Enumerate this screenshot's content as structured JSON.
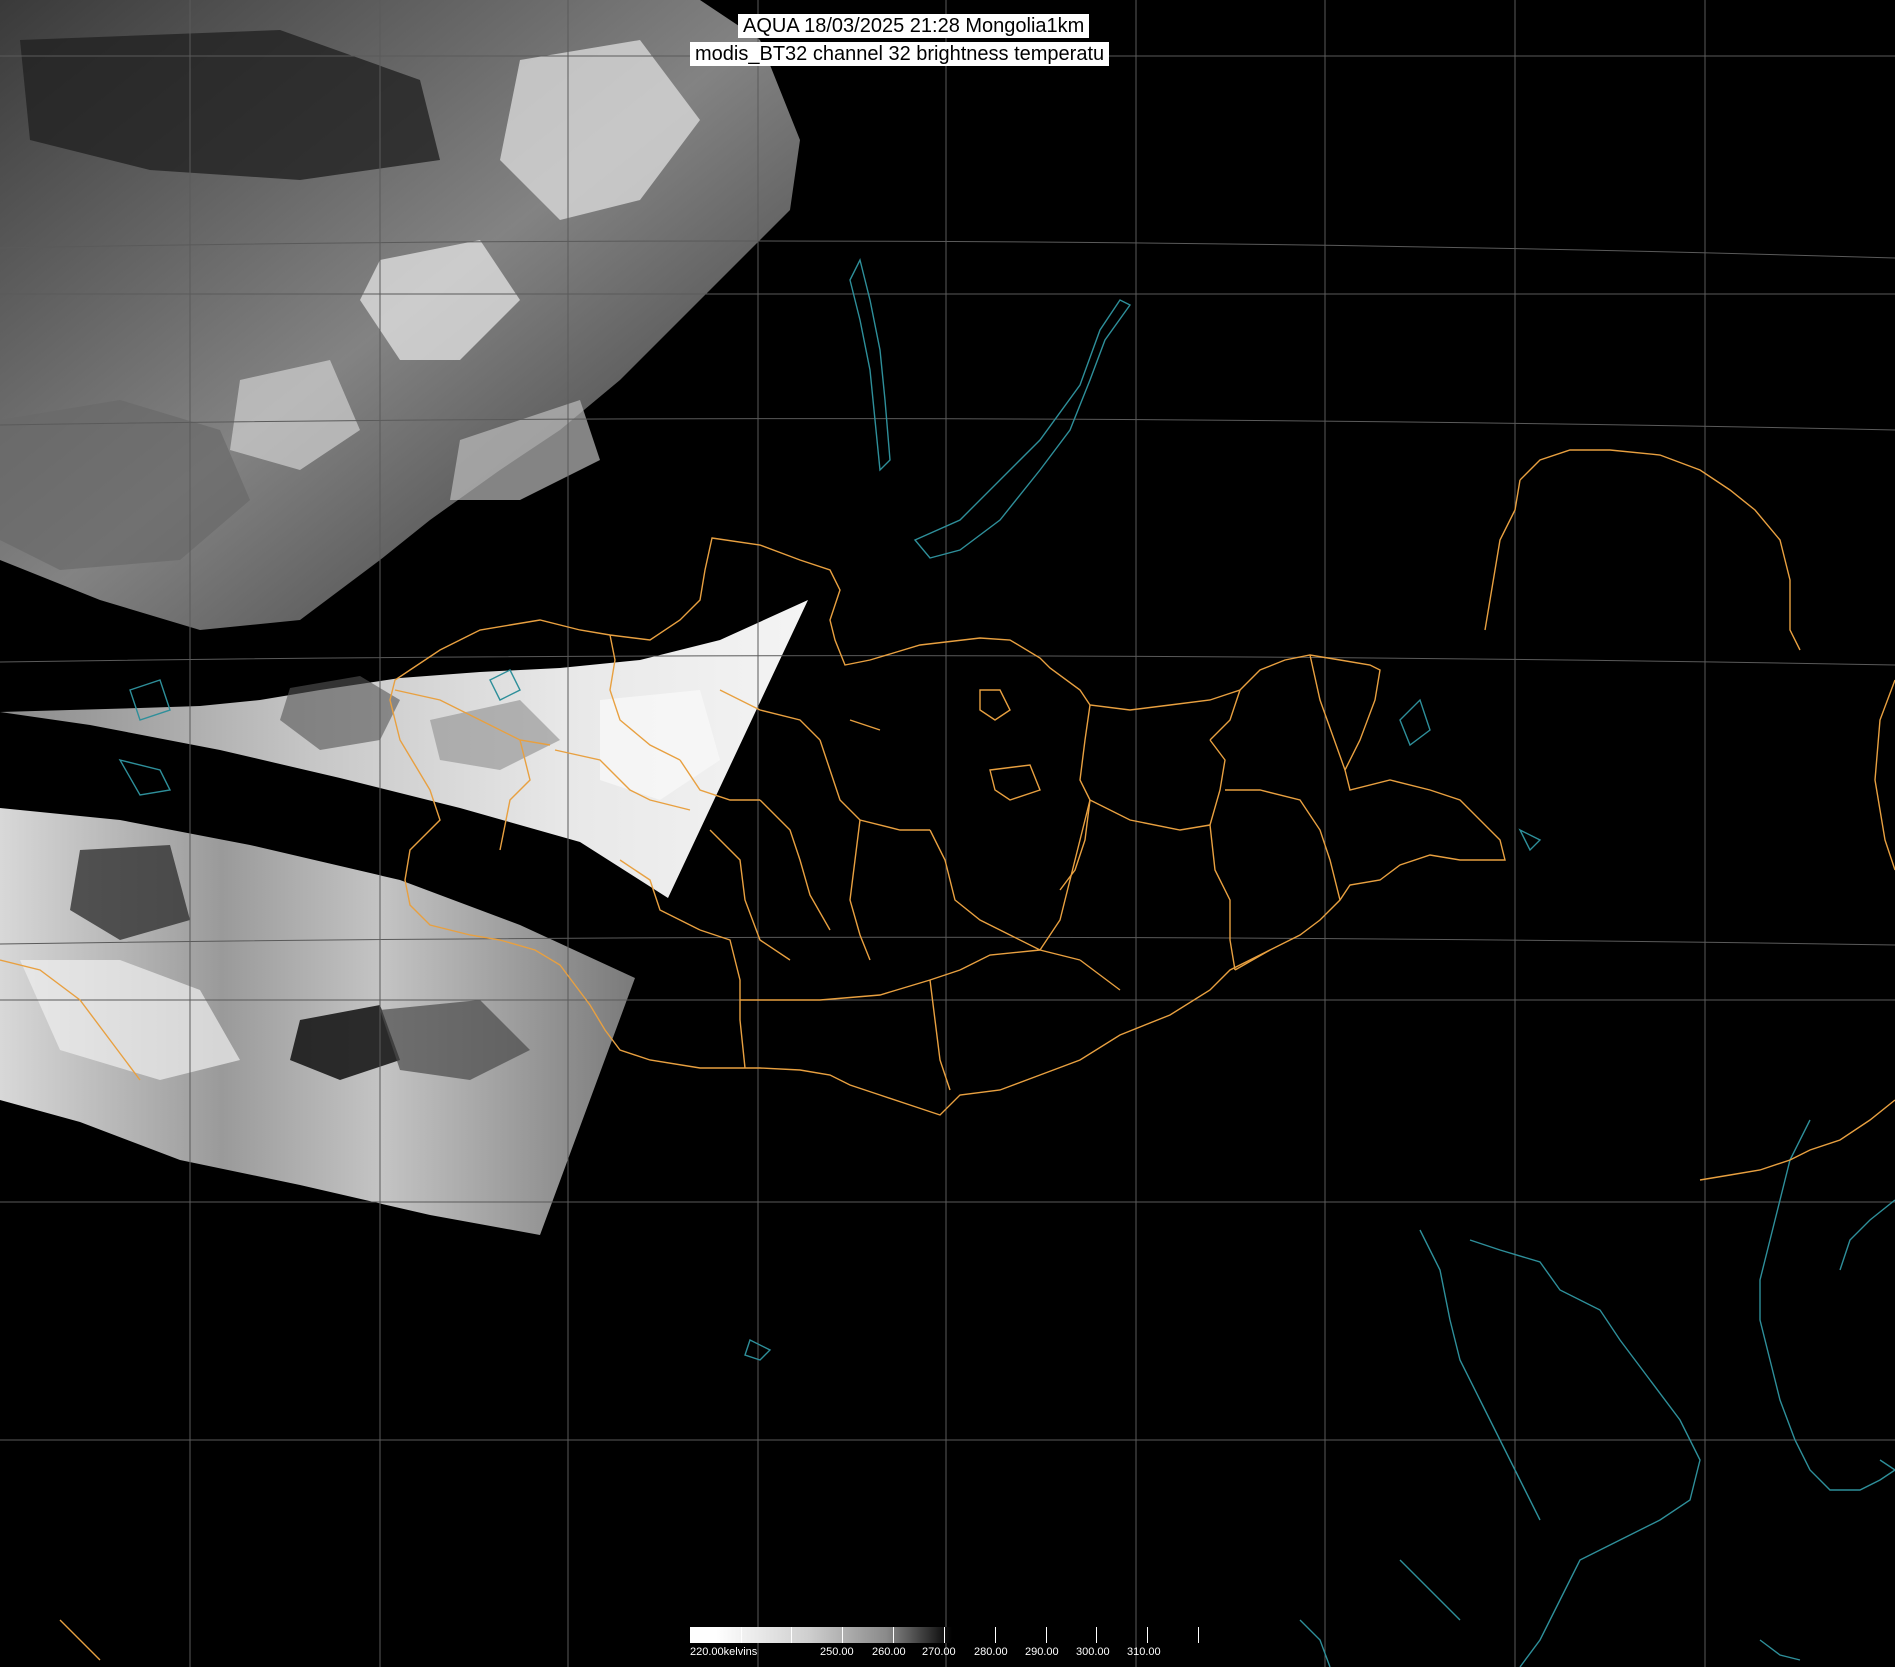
{
  "title": {
    "line1": "AQUA 18/03/2025 21:28 Mongolia1km",
    "line2": "modis_BT32 channel 32 brightness temperatu"
  },
  "colorbar": {
    "start_label": "220.00kelvins",
    "labels": [
      "250.00",
      "260.00",
      "270.00",
      "280.00",
      "290.00",
      "300.00",
      "310.00"
    ],
    "colors": [
      "#ffffff",
      "#000000"
    ]
  },
  "map_colors": {
    "background": "#000000",
    "grid": "#5a5a5a",
    "admin_borders": "#e8a040",
    "coastline_water": "#2e8f9a"
  }
}
